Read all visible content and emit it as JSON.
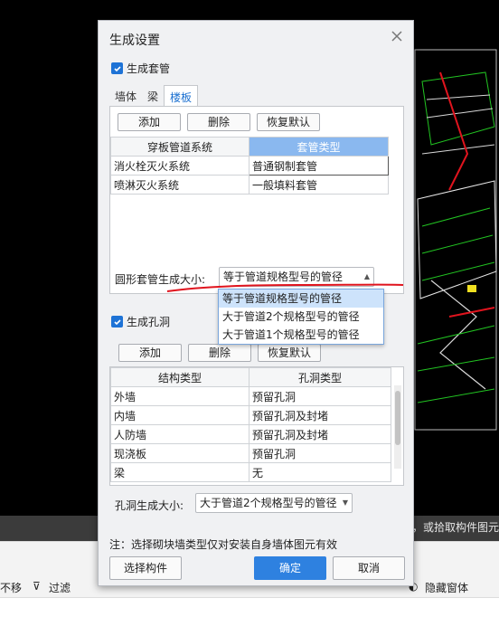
{
  "dialog": {
    "title": "生成设置",
    "generate_sleeve_label": "生成套管",
    "tabs": [
      "墙体",
      "梁",
      "楼板"
    ],
    "active_tab": "楼板",
    "sleeve_buttons": {
      "add": "添加",
      "delete": "删除",
      "restore": "恢复默认"
    },
    "sleeve_table": {
      "columns": [
        "穿板管道系统",
        "套管类型"
      ],
      "rows": [
        [
          "消火栓灭火系统",
          "普通钢制套管"
        ],
        [
          "喷淋灭火系统",
          "一般填料套管"
        ]
      ]
    },
    "round_sleeve_label": "圆形套管生成大小:",
    "round_sleeve_value": "等于管道规格型号的管径",
    "round_sleeve_options": [
      "等于管道规格型号的管径",
      "大于管道2个规格型号的管径",
      "大于管道1个规格型号的管径"
    ],
    "generate_hole_label": "生成孔洞",
    "hole_buttons": {
      "add": "添加",
      "delete": "删除",
      "restore": "恢复默认"
    },
    "hole_table": {
      "columns": [
        "结构类型",
        "孔洞类型"
      ],
      "rows": [
        [
          "外墙",
          "预留孔洞"
        ],
        [
          "内墙",
          "预留孔洞及封堵"
        ],
        [
          "人防墙",
          "预留孔洞及封堵"
        ],
        [
          "现浇板",
          "预留孔洞"
        ],
        [
          "梁",
          "无"
        ]
      ]
    },
    "hole_size_label": "孔洞生成大小:",
    "hole_size_value": "大于管道2个规格型号的管径",
    "note": "注：选择砌块墙类型仅对安装自身墙体图元有效",
    "select_component_button": "选择构件",
    "ok_button": "确定",
    "cancel_button": "取消"
  },
  "status_bar": {
    "text": "点，或拾取构件图元"
  },
  "bottom_toolbar": {
    "move": "不移",
    "filter": "过滤",
    "hide_window": "隐藏窗体"
  },
  "colors": {
    "accent": "#2e81e0",
    "selected_header": "#8ab8ef",
    "annotation_red": "#e0141e"
  }
}
